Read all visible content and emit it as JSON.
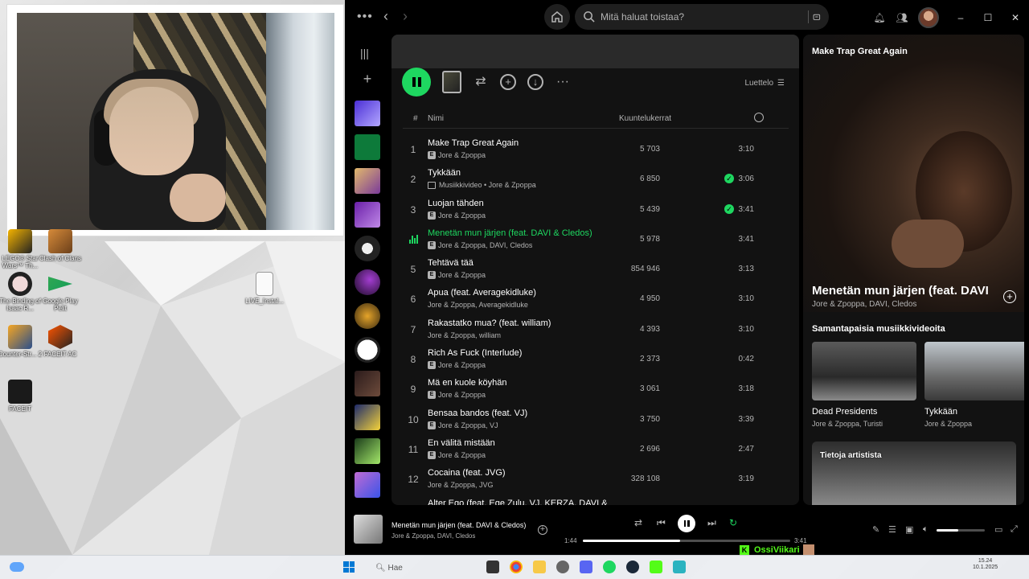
{
  "desktop": {
    "icons": [
      {
        "label": "LEGO® Star Wars™ Th..."
      },
      {
        "label": "Clash of Clans"
      },
      {
        "label": "The Binding of Isaac R..."
      },
      {
        "label": "Google Play Pelit"
      },
      {
        "label": "LIVE_Instal..."
      },
      {
        "label": "Counter-Str... 2"
      },
      {
        "label": "FACEIT AC"
      },
      {
        "label": "FACEIT"
      }
    ]
  },
  "search": {
    "placeholder": "Mitä haluat toistaa?"
  },
  "playlist": {
    "view_label": "Luettelo",
    "columns": {
      "num": "#",
      "name": "Nimi",
      "plays": "Kuuntelukerrat"
    },
    "tracks": [
      {
        "num": "1",
        "title": "Make Trap Great Again",
        "artists": "Jore & Zpoppa",
        "explicit": true,
        "video": false,
        "plays": "5 703",
        "saved": false,
        "duration": "3:10",
        "playing": false
      },
      {
        "num": "2",
        "title": "Tykkään",
        "artists": "Musiikkivideo • Jore & Zpoppa",
        "explicit": false,
        "video": true,
        "plays": "6 850",
        "saved": true,
        "duration": "3:06",
        "playing": false
      },
      {
        "num": "3",
        "title": "Luojan tähden",
        "artists": "Jore & Zpoppa",
        "explicit": true,
        "video": false,
        "plays": "5 439",
        "saved": true,
        "duration": "3:41",
        "playing": false
      },
      {
        "num": "",
        "title": "Menetän mun järjen (feat. DAVI & Cledos)",
        "artists": "Jore & Zpoppa, DAVI, Cledos",
        "explicit": true,
        "video": false,
        "plays": "5 978",
        "saved": false,
        "duration": "3:41",
        "playing": true
      },
      {
        "num": "5",
        "title": "Tehtävä tää",
        "artists": "Jore & Zpoppa",
        "explicit": true,
        "video": false,
        "plays": "854 946",
        "saved": false,
        "duration": "3:13",
        "playing": false
      },
      {
        "num": "6",
        "title": "Apua (feat. Averagekidluke)",
        "artists": "Jore & Zpoppa, Averagekidluke",
        "explicit": false,
        "video": false,
        "plays": "4 950",
        "saved": false,
        "duration": "3:10",
        "playing": false
      },
      {
        "num": "7",
        "title": "Rakastatko mua? (feat. william)",
        "artists": "Jore & Zpoppa, william",
        "explicit": false,
        "video": false,
        "plays": "4 393",
        "saved": false,
        "duration": "3:10",
        "playing": false
      },
      {
        "num": "8",
        "title": "Rich As Fuck (Interlude)",
        "artists": "Jore & Zpoppa",
        "explicit": true,
        "video": false,
        "plays": "2 373",
        "saved": false,
        "duration": "0:42",
        "playing": false
      },
      {
        "num": "9",
        "title": "Mä en kuole köyhän",
        "artists": "Jore & Zpoppa",
        "explicit": true,
        "video": false,
        "plays": "3 061",
        "saved": false,
        "duration": "3:18",
        "playing": false
      },
      {
        "num": "10",
        "title": "Bensaa bandos (feat. VJ)",
        "artists": "Jore & Zpoppa, VJ",
        "explicit": true,
        "video": false,
        "plays": "3 750",
        "saved": false,
        "duration": "3:39",
        "playing": false
      },
      {
        "num": "11",
        "title": "En välitä mistään",
        "artists": "Jore & Zpoppa",
        "explicit": true,
        "video": false,
        "plays": "2 696",
        "saved": false,
        "duration": "2:47",
        "playing": false
      },
      {
        "num": "12",
        "title": "Cocaina (feat. JVG)",
        "artists": "Jore & Zpoppa, JVG",
        "explicit": false,
        "video": false,
        "plays": "328 108",
        "saved": false,
        "duration": "3:19",
        "playing": false
      },
      {
        "num": "13",
        "title": "Alter Ego (feat. Ege Zulu, VJ, KERZA, DAVI &",
        "artists": "",
        "explicit": false,
        "video": false,
        "plays": "",
        "saved": false,
        "duration": "",
        "playing": false
      }
    ]
  },
  "now_playing": {
    "header": "Make Trap Great Again",
    "title": "Menetän mun järjen (feat. DAVI",
    "artists": "Jore & Zpoppa, DAVI, Cledos",
    "similar_title": "Samantapaisia musiikkivideoita",
    "videos": [
      {
        "name": "Dead Presidents",
        "artists": "Jore & Zpoppa, Turisti"
      },
      {
        "name": "Tykkään",
        "artists": "Jore & Zpoppa"
      }
    ],
    "about_label": "Tietoja artistista"
  },
  "player": {
    "track": "Menetän mun järjen (feat. DAVI & Cledos)",
    "artists": "Jore & Zpoppa, DAVI, Cledos",
    "elapsed": "1:44",
    "total": "3:41",
    "progress_fraction": 0.47,
    "volume_fraction": 0.45
  },
  "overlay": {
    "username": "OssiViikari"
  },
  "taskbar": {
    "search_label": "Hae",
    "time": "15.24",
    "date": "10.1.2025"
  },
  "colors": {
    "accent": "#1ed760",
    "background": "#121212"
  }
}
